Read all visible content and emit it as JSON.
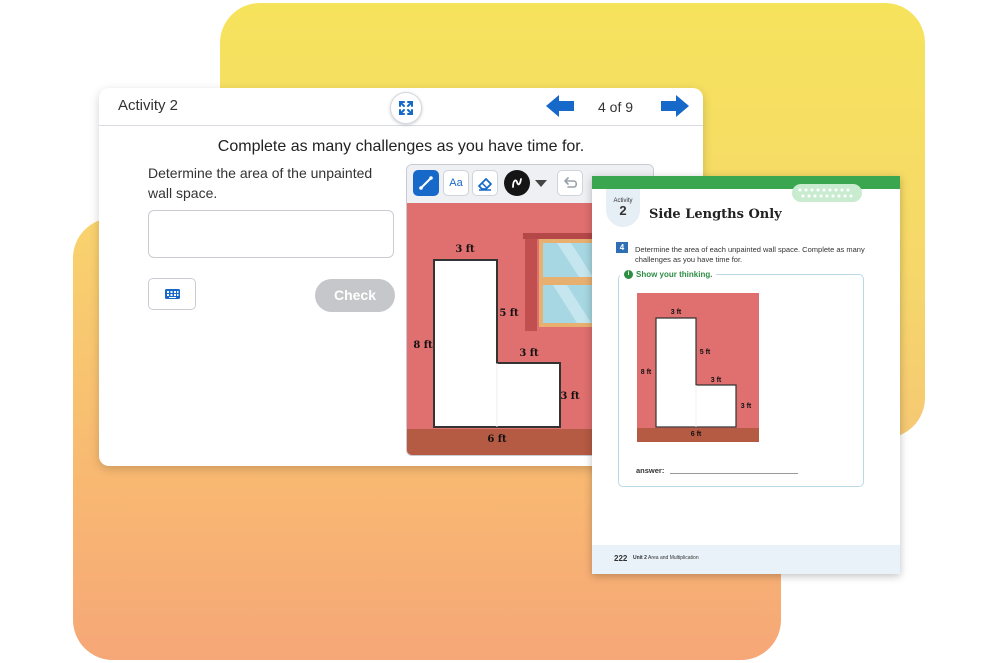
{
  "activity_window": {
    "title": "Activity 2",
    "page_indicator": "4 of 9",
    "instruction": "Complete as many challenges as you have time for.",
    "prompt": "Determine the area of the unpainted wall space.",
    "answer_value": "",
    "check_label": "Check",
    "icons": {
      "expand": "expand-icon",
      "previous": "arrow-left-icon",
      "next": "arrow-right-icon",
      "keyboard": "keyboard-icon"
    }
  },
  "sketch_panel": {
    "tools": [
      "line-tool-icon",
      "text-tool-icon",
      "eraser-icon",
      "color-picker-icon",
      "undo-icon"
    ],
    "text_tool_label": "Aa",
    "figure_labels": {
      "top": "3 ft",
      "inner_vertical": "5 ft",
      "left": "8 ft",
      "inner_horizontal": "3 ft",
      "right": "3 ft",
      "bottom": "6 ft"
    }
  },
  "workbook_page": {
    "tab_word": "Activity",
    "tab_number": "2",
    "title": "Side Lengths Only",
    "task_number": "4",
    "task_text": "Determine the area of each unpainted wall space. Complete as many challenges as you have time for.",
    "show_thinking": "Show your thinking.",
    "figure_labels": {
      "top": "3 ft",
      "inner_vertical": "5 ft",
      "left": "8 ft",
      "inner_horizontal": "3 ft",
      "right": "3 ft",
      "bottom": "6 ft"
    },
    "answer_label": "answer:",
    "footer_page": "222",
    "footer_unit_bold": "Unit 2",
    "footer_unit_title": "Area and Multiplication"
  },
  "colors": {
    "wall": "#e06f6f",
    "floor": "#b55a43",
    "accent_blue": "#1769c9",
    "workbook_green": "#3aa64f",
    "check_disabled": "#c5c7ca"
  }
}
